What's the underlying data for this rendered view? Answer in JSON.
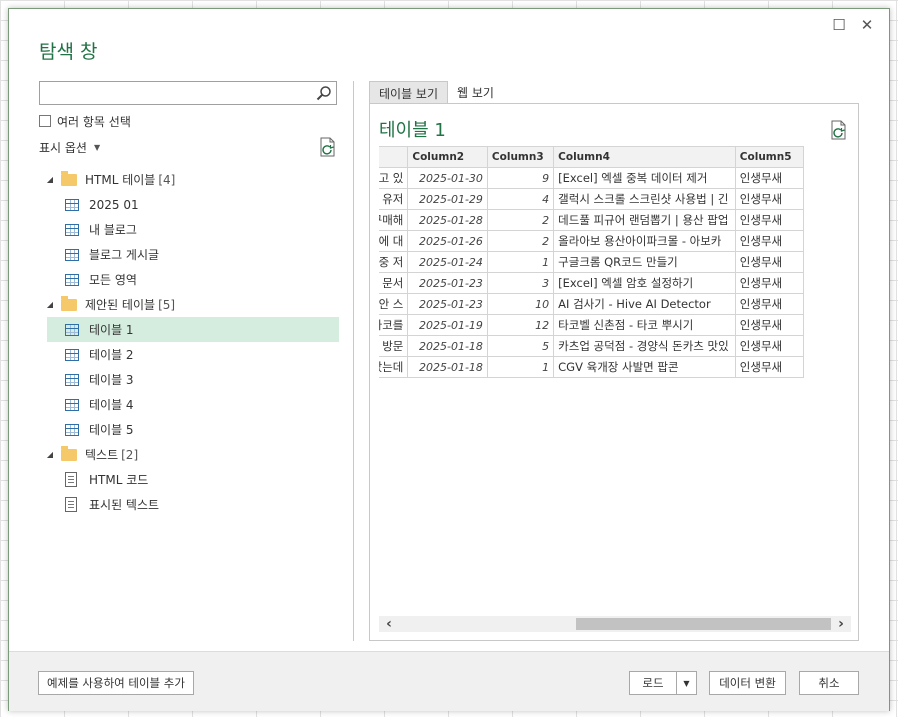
{
  "window": {
    "title": "탐색 창"
  },
  "search": {
    "placeholder": "",
    "value": ""
  },
  "options": {
    "multi_select_label": "여러 항목 선택",
    "display_options_label": "표시 옵션"
  },
  "tree": {
    "groups": [
      {
        "label": "HTML 테이블",
        "count": "[4]",
        "items": [
          "2025 01",
          "내 블로그",
          "블로그 게시글",
          "모든 영역"
        ]
      },
      {
        "label": "제안된 테이블",
        "count": "[5]",
        "items": [
          "테이블 1",
          "테이블 2",
          "테이블 3",
          "테이블 4",
          "테이블 5"
        ]
      },
      {
        "label": "텍스트",
        "count": "[2]",
        "items": [
          "HTML 코드",
          "표시된 텍스트"
        ]
      }
    ],
    "selected": "테이블 1"
  },
  "tabs": {
    "table_view": "테이블 보기",
    "web_view": "웹 보기"
  },
  "preview": {
    "title": "테이블 1",
    "columns": [
      "",
      "Column2",
      "Column3",
      "Column4",
      "Column5"
    ],
    "rows": [
      [
        "급하고 있",
        "2025-01-30",
        "9",
        "[Excel] 엑셀 중복 데이터 제거",
        "인생무새"
      ],
      [
        "력시 유저",
        "2025-01-29",
        "4",
        "갤럭시 스크롤 스크린샷 사용법 | 긴",
        "인생무새"
      ],
      [
        ": 구매해",
        "2025-01-28",
        "2",
        "데드풀 피규어 랜덤뽑기 | 용산 팝업",
        "인생무새"
      ],
      [
        "당에 대",
        "2025-01-26",
        "2",
        "올라아보 용산아이파크몰 - 아보카",
        "인생무새"
      ],
      [
        "나.그중 저",
        "2025-01-24",
        "1",
        "구글크롬 QR코드 만들기",
        "인생무새"
      ],
      [
        "엑셀 문서",
        "2025-01-23",
        "3",
        "[Excel] 엑셀 암호 설정하기",
        "인생무새"
      ],
      [
        "대에 안 스",
        "2025-01-23",
        "10",
        "AI 검사기 - Hive AI Detector",
        "인생무새"
      ],
      [
        "전 타코를",
        "2025-01-19",
        "12",
        "타코벨 신촌점 - 타코 뿌시기",
        "인생무새"
      ],
      [
        "점에 방문",
        "2025-01-18",
        "5",
        "카츠업 공덕점 - 경양식 돈카츠 맛있",
        "인생무새"
      ],
      [
        "러 갔는데",
        "2025-01-18",
        "1",
        "CGV 육개장 사발면 팝콘",
        "인생무새"
      ]
    ]
  },
  "footer": {
    "add_table_label": "예제를 사용하여 테이블 추가",
    "load_label": "로드",
    "transform_label": "데이터 변환",
    "cancel_label": "취소"
  }
}
